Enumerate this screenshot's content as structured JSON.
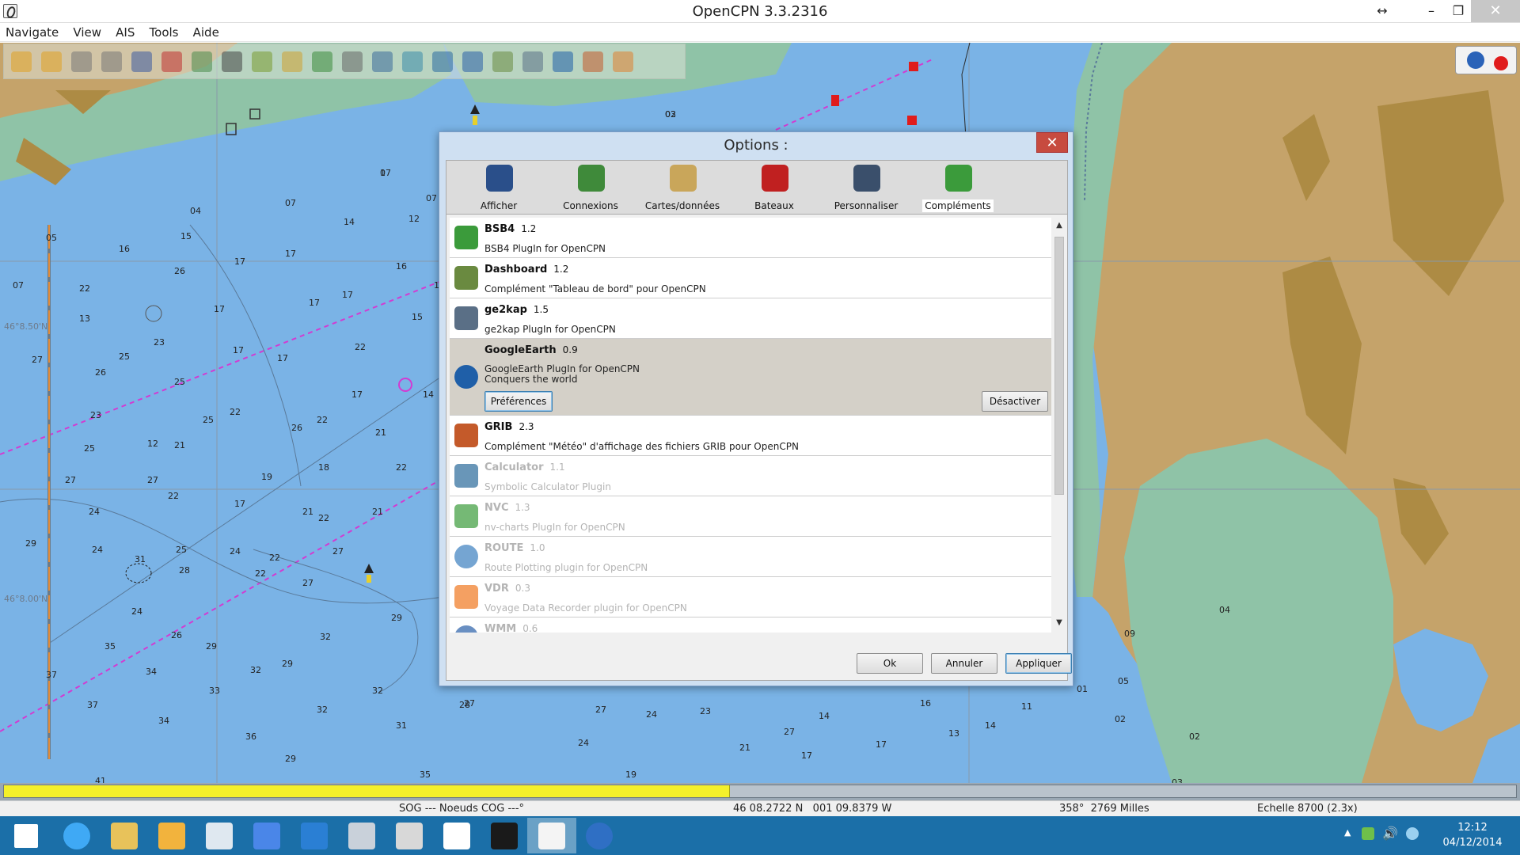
{
  "window": {
    "title": "OpenCPN 3.3.2316"
  },
  "menu": [
    "Navigate",
    "View",
    "AIS",
    "Tools",
    "Aide"
  ],
  "toolbar_icons": [
    "zoom-in-icon",
    "zoom-out-icon",
    "scale-in-icon",
    "scale-out-icon",
    "route-icon",
    "track-icon",
    "measure-icon",
    "text-icon",
    "pencil-icon",
    "chart-quilt-icon",
    "layers-icon",
    "print-icon",
    "chart-icon",
    "weather-icon",
    "tides-icon",
    "help-icon",
    "dashboard-icon",
    "ge2kap-icon",
    "google-earth-icon",
    "grib-icon",
    "lifebuoy-icon"
  ],
  "chart": {
    "lat_labels": [
      "46°8.50'N",
      "46°8.00'N"
    ],
    "depths": [
      "03",
      "07",
      "04",
      "07",
      "12",
      "05",
      "15",
      "16",
      "17",
      "17",
      "14",
      "16",
      "17",
      "07",
      "12",
      "07",
      "22",
      "26",
      "17",
      "17",
      "17",
      "15",
      "13",
      "26",
      "17",
      "22",
      "25",
      "27",
      "23",
      "17",
      "22",
      "23",
      "25",
      "22",
      "21",
      "14",
      "12",
      "25",
      "26",
      "25",
      "22",
      "21",
      "19",
      "18",
      "27",
      "27",
      "24",
      "22",
      "17",
      "21",
      "29",
      "24",
      "22",
      "22",
      "27",
      "21",
      "24",
      "25",
      "22",
      "31",
      "28",
      "27",
      "24",
      "26",
      "32",
      "29",
      "35",
      "34",
      "32",
      "29",
      "32",
      "29",
      "37",
      "33",
      "32",
      "28",
      "37",
      "34",
      "36",
      "31",
      "29",
      "35",
      "41",
      "27",
      "27",
      "24",
      "23",
      "21",
      "27",
      "24",
      "19",
      "17",
      "14",
      "17",
      "16",
      "13",
      "14",
      "11",
      "05",
      "02",
      "02",
      "03",
      "01",
      "09",
      "04",
      "02",
      "1"
    ]
  },
  "dialog": {
    "title": "Options :",
    "close": "✕",
    "tabs": [
      {
        "label": "Afficher",
        "icon": "monitor-icon",
        "color": "#2a4f8a"
      },
      {
        "label": "Connexions",
        "icon": "connections-icon",
        "color": "#3f8a3a"
      },
      {
        "label": "Cartes/données",
        "icon": "charts-icon",
        "color": "#c9a65a"
      },
      {
        "label": "Bateaux",
        "icon": "boat-icon",
        "color": "#c02020"
      },
      {
        "label": "Personnaliser",
        "icon": "sliders-icon",
        "color": "#3a4f6b"
      },
      {
        "label": "Compléments",
        "icon": "puzzle-icon",
        "color": "#3b9b3b"
      }
    ],
    "active_tab": "Compléments",
    "plugins": [
      {
        "name": "BSB4",
        "version": "1.2",
        "desc": "BSB4 PlugIn for OpenCPN",
        "icon": "puzzle-icon",
        "color": "#3b9b3b",
        "enabled": true
      },
      {
        "name": "Dashboard",
        "version": "1.2",
        "desc": "Complément \"Tableau de bord\" pour OpenCPN",
        "icon": "dashboard-icon",
        "color": "#6a8a40",
        "enabled": true
      },
      {
        "name": "ge2kap",
        "version": "1.5",
        "desc": "ge2kap PlugIn for OpenCPN",
        "icon": "ge2kap-icon",
        "color": "#5a6f86",
        "enabled": true
      },
      {
        "name": "GoogleEarth",
        "version": "0.9",
        "desc": "GoogleEarth PlugIn for OpenCPN\nConquers the world",
        "icon": "google-earth-icon",
        "color": "#1f5fa8",
        "enabled": true,
        "selected": true,
        "pref_label": "Préférences",
        "deact_label": "Désactiver"
      },
      {
        "name": "GRIB",
        "version": "2.3",
        "desc": "Complément \"Météo\" d'affichage des fichiers GRIB pour OpenCPN",
        "icon": "grib-icon",
        "color": "#c45a2a",
        "enabled": true
      },
      {
        "name": "Calculator",
        "version": "1.1",
        "desc": "Symbolic Calculator Plugin",
        "icon": "calculator-icon",
        "color": "#2a6a9a",
        "enabled": false
      },
      {
        "name": "NVC",
        "version": "1.3",
        "desc": "nv-charts PlugIn for OpenCPN",
        "icon": "puzzle-icon",
        "color": "#3b9b3b",
        "enabled": false
      },
      {
        "name": "ROUTE",
        "version": "1.0",
        "desc": "Route Plotting plugin for OpenCPN",
        "icon": "globe-icon",
        "color": "#3a7fbf",
        "enabled": false
      },
      {
        "name": "VDR",
        "version": "0.3",
        "desc": "Voyage Data Recorder plugin for OpenCPN",
        "icon": "recorder-icon",
        "color": "#f07820",
        "enabled": false
      },
      {
        "name": "WMM",
        "version": "0.6",
        "desc": "",
        "icon": "globe-icon",
        "color": "#2a5fa8",
        "enabled": false
      }
    ],
    "buttons": {
      "ok": "Ok",
      "cancel": "Annuler",
      "apply": "Appliquer"
    }
  },
  "progress": {
    "value": 0.48
  },
  "status": {
    "sog_cog": "SOG --- Noeuds COG ---°",
    "position": "46 08.2722 N   001 09.8379 W",
    "bearing": "358°  2769 Milles",
    "scale": "Echelle 8700 (2.3x)"
  },
  "taskbar": {
    "apps": [
      {
        "icon": "windows-start-icon",
        "color": "#ffffff"
      },
      {
        "icon": "internet-explorer-icon",
        "color": "#3fa9f5"
      },
      {
        "icon": "file-explorer-icon",
        "color": "#e8c25a"
      },
      {
        "icon": "outlook-icon",
        "color": "#f2b33d"
      },
      {
        "icon": "sailboat-app-icon",
        "color": "#dfe8f0"
      },
      {
        "icon": "google-icon",
        "color": "#4a86e8"
      },
      {
        "icon": "teamviewer-icon",
        "color": "#2a7fd4"
      },
      {
        "icon": "scanner-icon",
        "color": "#c9d1da"
      },
      {
        "icon": "tool-app-icon",
        "color": "#d8d8d8"
      },
      {
        "icon": "sheet-app-icon",
        "color": "#ffffff"
      },
      {
        "icon": "plus-app-icon",
        "color": "#1a1a1a"
      },
      {
        "icon": "opencpn-app-icon",
        "color": "#f4f4f4"
      },
      {
        "icon": "google-earth-app-icon",
        "color": "#2f6fc4"
      }
    ],
    "active_app": "opencpn-app-icon",
    "clock_time": "12:12",
    "clock_date": "04/12/2014"
  },
  "colors": {
    "sea": "#7ab3e6",
    "shallow": "#8fc3a7",
    "land": "#c5a36a",
    "route_line": "#d23bd2",
    "taskbar": "#1b6fa8"
  }
}
